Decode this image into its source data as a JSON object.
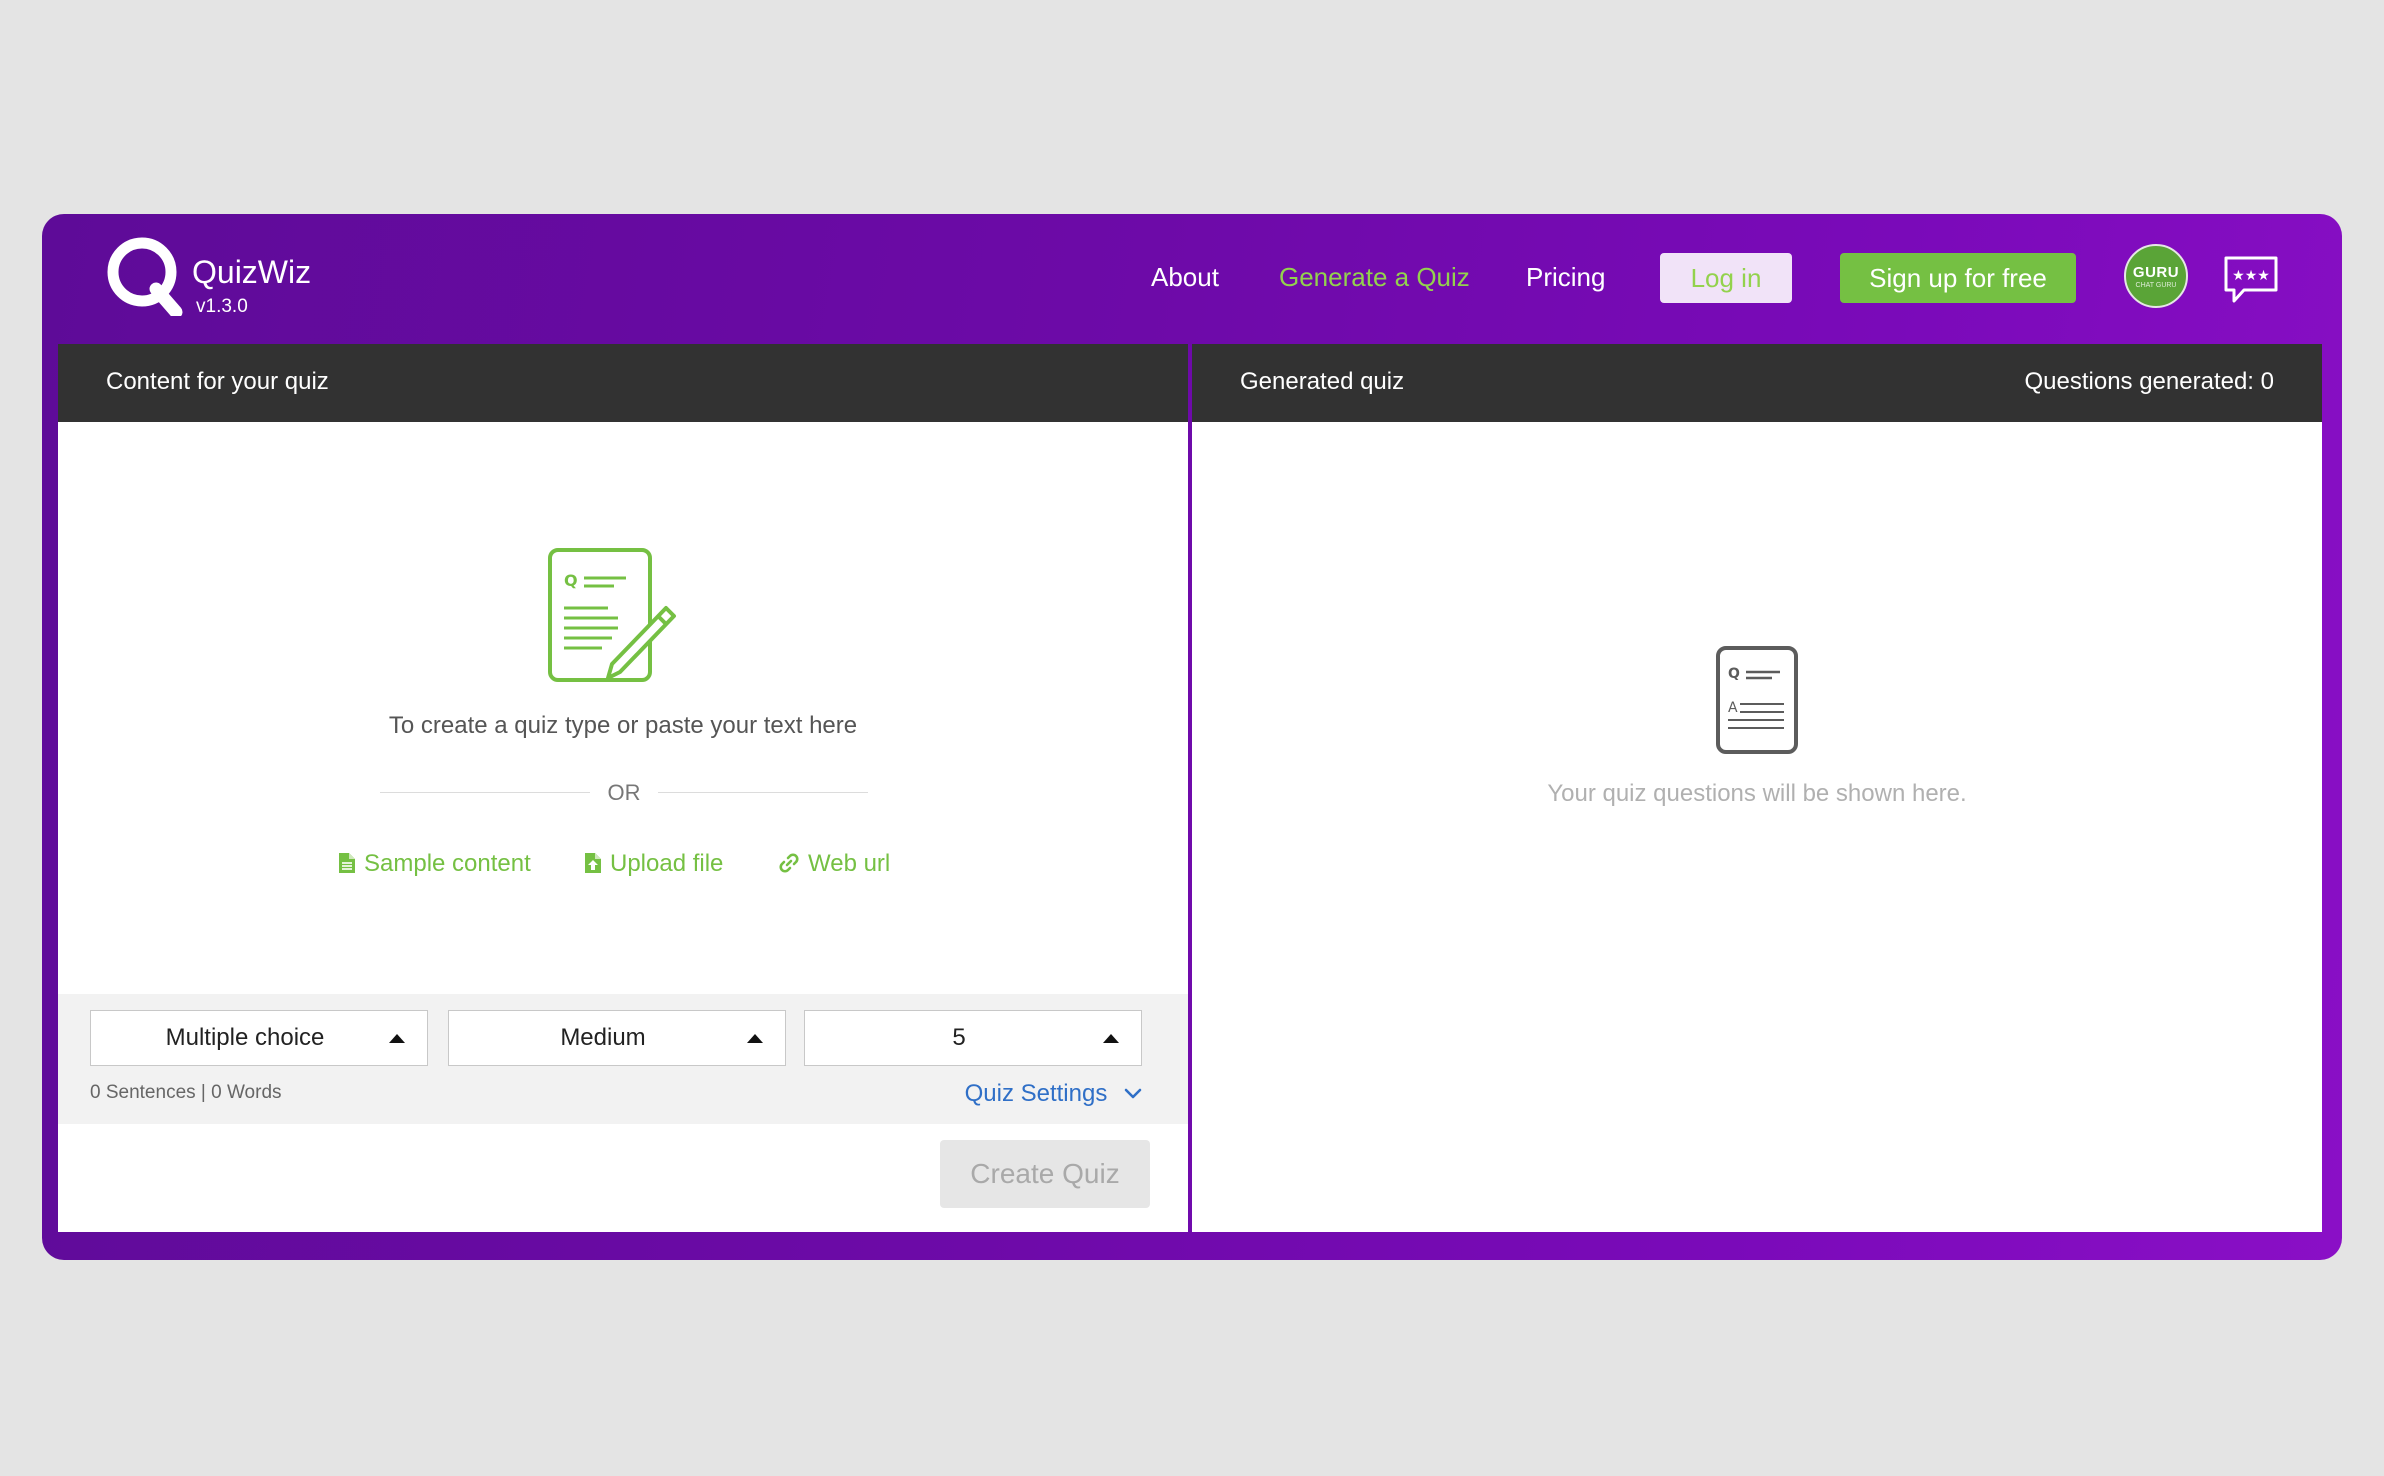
{
  "app": {
    "name": "QuizWiz",
    "version": "v1.3.0"
  },
  "nav": {
    "about": "About",
    "generate": "Generate a Quiz",
    "pricing": "Pricing",
    "login": "Log in",
    "signup": "Sign up for free",
    "avatar_text": "GURU",
    "avatar_subtext": "CHAT GURU"
  },
  "left_panel": {
    "title": "Content for your quiz",
    "prompt": "To create a quiz type or paste your text here",
    "or": "OR",
    "links": {
      "sample": "Sample content",
      "upload": "Upload file",
      "web": "Web url"
    },
    "selects": {
      "type": "Multiple choice",
      "difficulty": "Medium",
      "count": "5"
    },
    "counts": "0 Sentences | 0 Words",
    "settings": "Quiz Settings",
    "create": "Create Quiz"
  },
  "right_panel": {
    "title": "Generated quiz",
    "count": "Questions generated: 0",
    "placeholder": "Your quiz questions will be shown here."
  },
  "colors": {
    "brand_purple": "#6d0aa8",
    "accent_green": "#75c043",
    "link_blue": "#2f6fc7",
    "header_dark": "#323232"
  }
}
